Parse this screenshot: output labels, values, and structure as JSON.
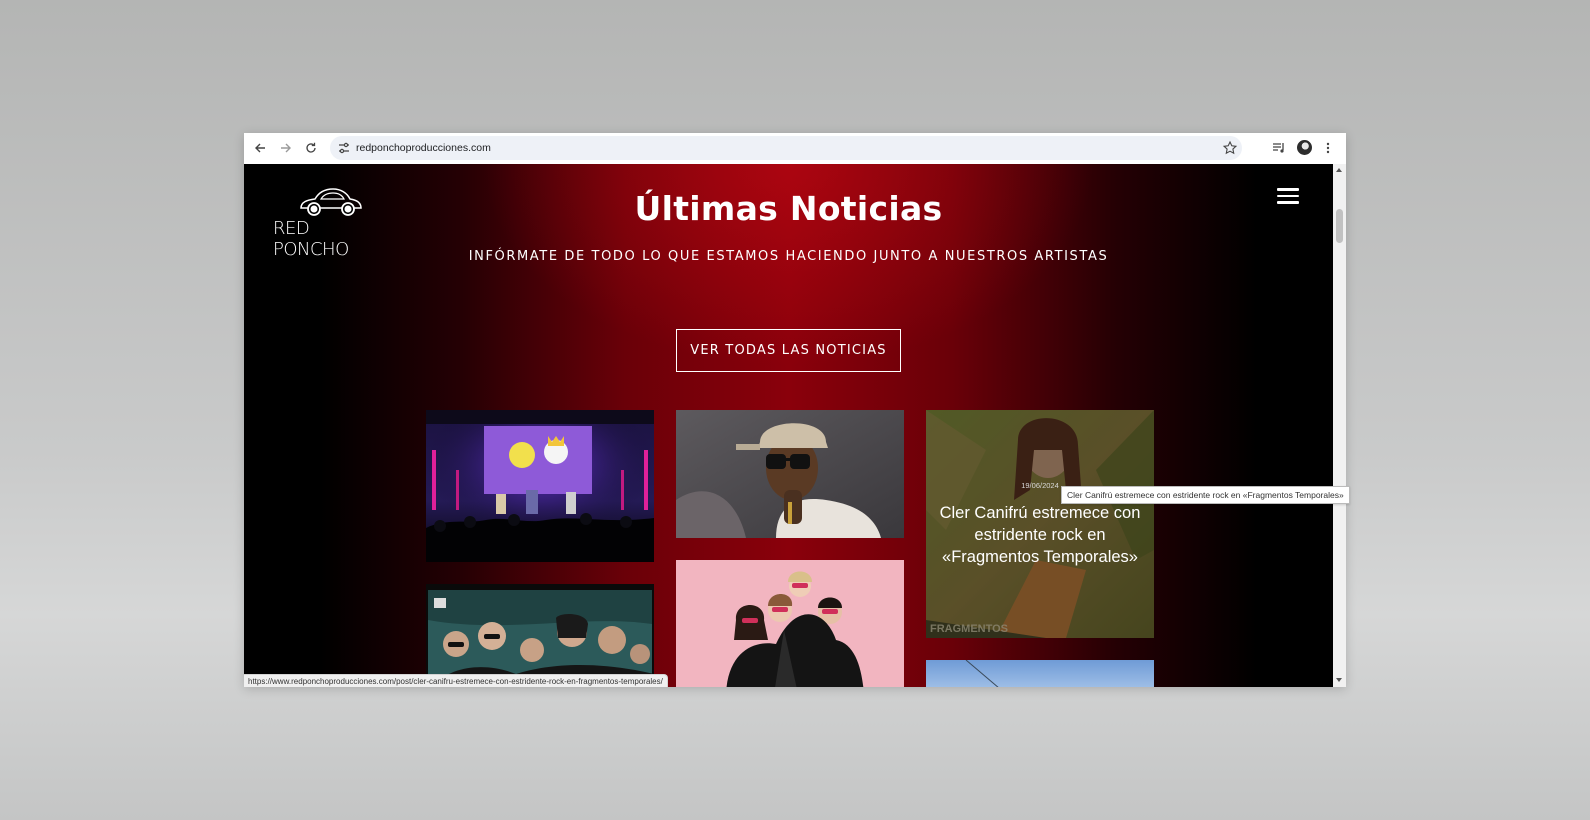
{
  "browser": {
    "url": "redponchoproducciones.com",
    "status_url": "https://www.redponchoproducciones.com/post/cler-canifru-estremece-con-estridente-rock-en-fragmentos-temporales/",
    "icons": [
      "back-icon",
      "forward-icon",
      "reload-icon",
      "site-settings-icon",
      "bookmark-star-icon",
      "media-control-icon",
      "profile-avatar",
      "more-menu-icon"
    ]
  },
  "header": {
    "logo_text": "RED PONCHO",
    "title": "Últimas Noticias",
    "subtitle": "INFÓRMATE DE TODO LO QUE ESTAMOS HACIENDO JUNTO A NUESTROS ARTISTAS",
    "cta_label": "VER TODAS LAS NOTICIAS"
  },
  "posts": [
    {
      "image": "concert-stage-photo"
    },
    {
      "image": "artist-sunglasses-photo"
    },
    {
      "image": "cler-canifru-photo",
      "date": "19/06/2024",
      "title": "Cler Canifrú estremece con estridente rock en «Fragmentos Temporales»",
      "hovered": true
    },
    {
      "image": "band-group-photo"
    },
    {
      "image": "pink-band-photo"
    },
    {
      "image": "sky-photo"
    }
  ],
  "tooltip": "Cler Canifrú estremece con estridente rock en «Fragmentos Temporales»",
  "colors": {
    "accent_red": "#8a000b",
    "background": "#000000",
    "text": "#ffffff"
  }
}
